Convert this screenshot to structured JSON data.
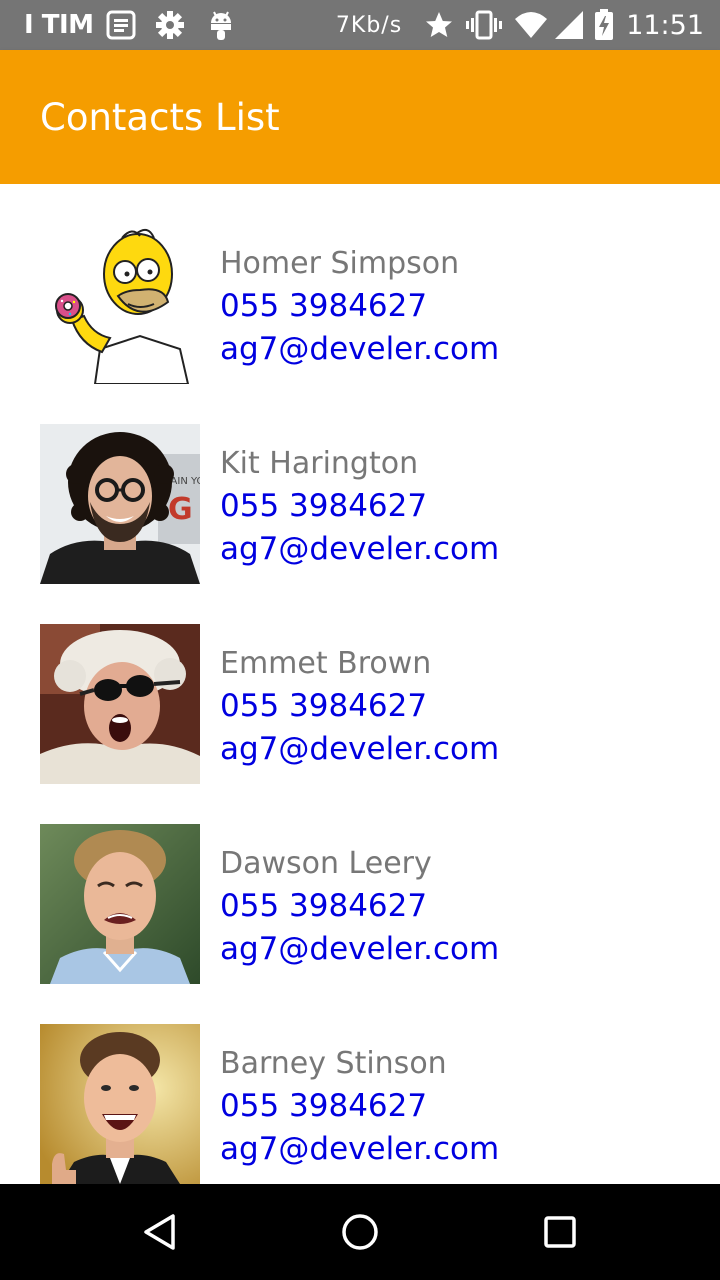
{
  "status_bar": {
    "carrier": "I TIM",
    "net_speed": "7Kb/s",
    "time": "11:51",
    "icons": [
      "notes-icon",
      "gear-icon",
      "android-icon",
      "star-icon",
      "vibrate-icon",
      "wifi-icon",
      "signal-icon",
      "battery-charging-icon"
    ]
  },
  "app_bar": {
    "title": "Contacts List",
    "color": "#f59d00"
  },
  "contacts": [
    {
      "name": "Homer Simpson",
      "phone": "055 3984627",
      "email": "ag7@develer.com"
    },
    {
      "name": "Kit Harington",
      "phone": "055 3984627",
      "email": "ag7@develer.com"
    },
    {
      "name": "Emmet Brown",
      "phone": "055 3984627",
      "email": "ag7@develer.com"
    },
    {
      "name": "Dawson Leery",
      "phone": "055 3984627",
      "email": "ag7@develer.com"
    },
    {
      "name": "Barney Stinson",
      "phone": "055 3984627",
      "email": "ag7@develer.com"
    }
  ],
  "colors": {
    "name_text": "#777777",
    "link_text": "#0000e0"
  },
  "nav_bar": {
    "buttons": [
      "back-icon",
      "home-icon",
      "recents-icon"
    ]
  }
}
